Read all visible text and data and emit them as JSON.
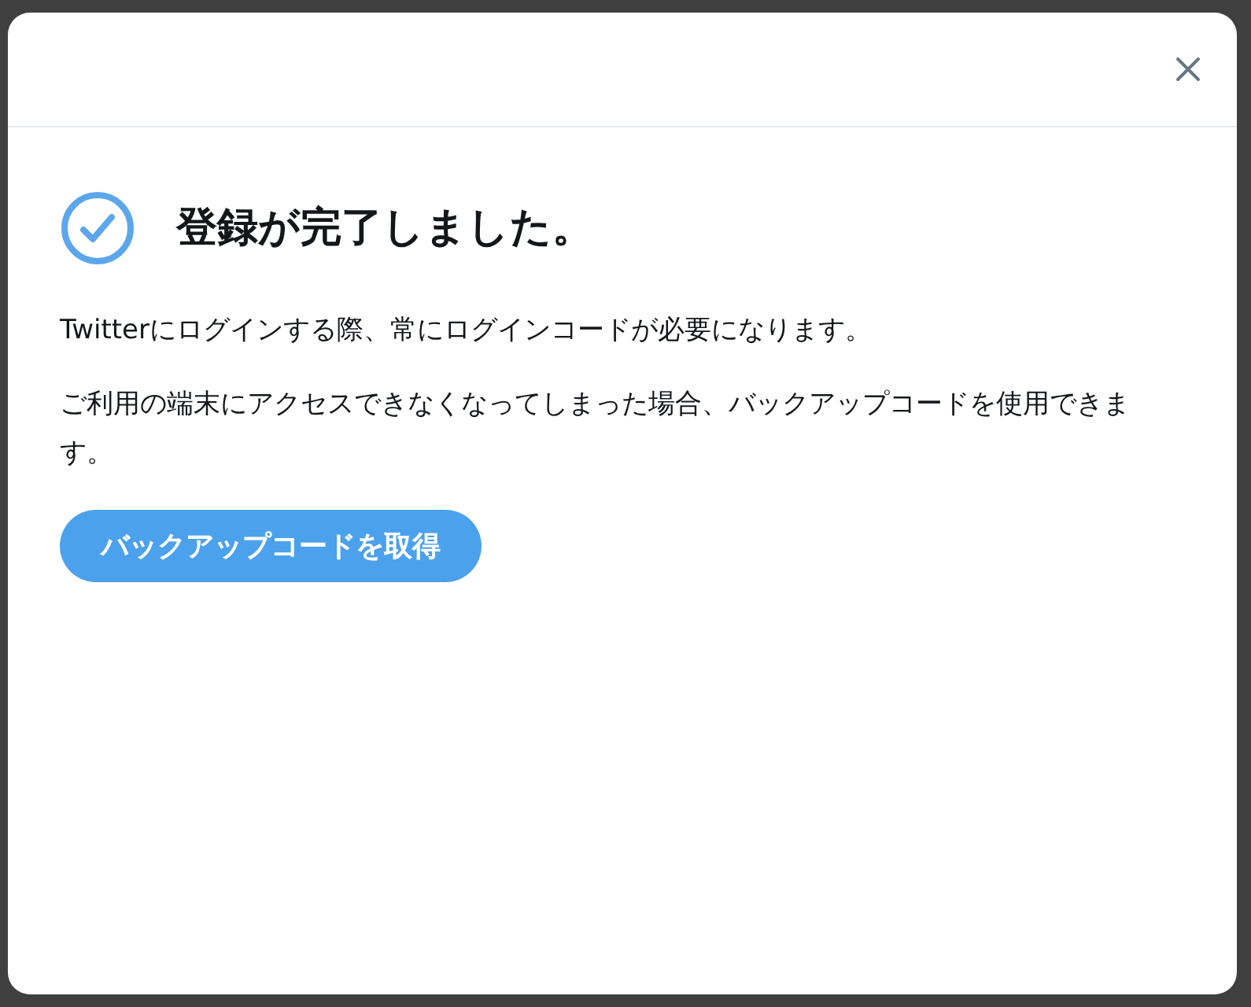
{
  "dialog": {
    "title": "登録が完了しました。",
    "paragraphs": [
      "Twitterにログインする際、常にログインコードが必要になります。",
      "ご利用の端末にアクセスできなくなってしまった場合、バックアップコードを使用できます。"
    ],
    "button": "バックアップコードを取得"
  }
}
